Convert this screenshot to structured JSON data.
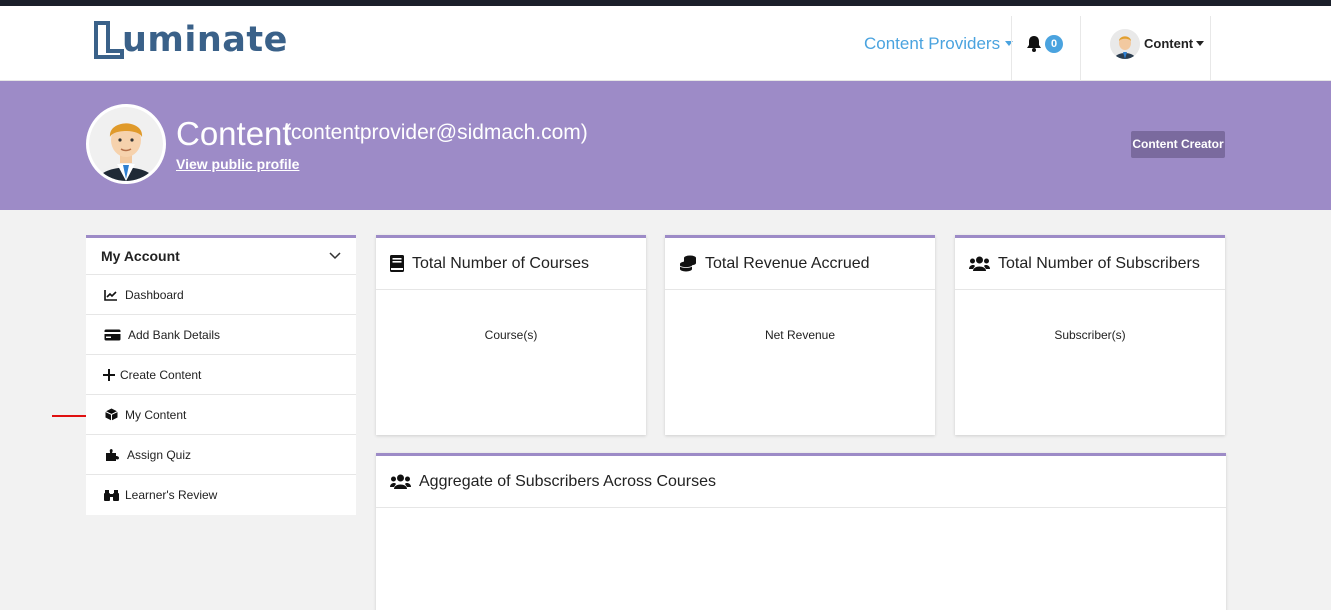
{
  "navbar": {
    "logo_text": "uminate",
    "providers_label": "Content Providers",
    "notification_count": "0",
    "user_label": "Content"
  },
  "profile": {
    "name": "Content",
    "email": "(contentprovider@sidmach.com)",
    "public_profile_link": "View public profile",
    "role_badge": "Content Creator"
  },
  "sidebar": {
    "heading": "My Account",
    "items": [
      {
        "label": "Dashboard",
        "icon": "chart-line-icon"
      },
      {
        "label": "Add Bank Details",
        "icon": "credit-card-icon"
      },
      {
        "label": "Create Content",
        "icon": "plus-icon"
      },
      {
        "label": "My Content",
        "icon": "cube-icon"
      },
      {
        "label": "Assign Quiz",
        "icon": "puzzle-icon"
      },
      {
        "label": "Learner's Review",
        "icon": "binoculars-icon"
      }
    ]
  },
  "cards": [
    {
      "title": "Total Number of Courses",
      "value_label": "Course(s)",
      "icon": "book-icon"
    },
    {
      "title": "Total Revenue Accrued",
      "value_label": "Net Revenue",
      "icon": "coins-icon"
    },
    {
      "title": "Total Number of Subscribers",
      "value_label": "Subscriber(s)",
      "icon": "users-icon"
    }
  ],
  "aggregate": {
    "title": "Aggregate of Subscribers Across Courses",
    "icon": "users-icon"
  },
  "colors": {
    "accent": "#9d8bc7",
    "link": "#4aa3df",
    "role_badge_bg": "#7a6a9e",
    "logo": "#3a6189"
  }
}
